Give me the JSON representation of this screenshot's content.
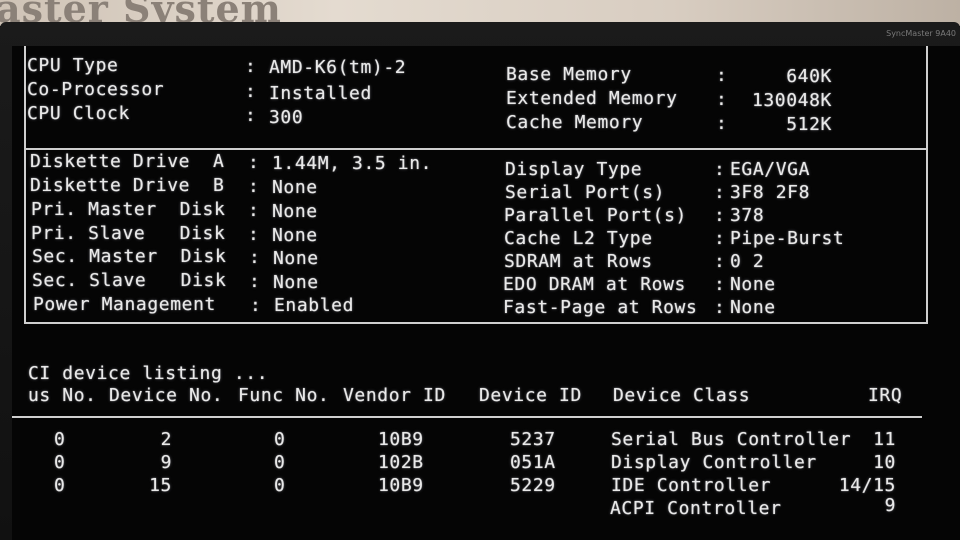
{
  "environment": {
    "wall_sign_text": "aster System",
    "monitor_brand": "SyncMaster 9A40"
  },
  "system": {
    "left": [
      {
        "label": "CPU Type",
        "value": "AMD-K6(tm)-2"
      },
      {
        "label": "Co-Processor",
        "value": "Installed"
      },
      {
        "label": "CPU Clock",
        "value": "300"
      }
    ],
    "right": [
      {
        "label": "Base Memory",
        "value": "640K"
      },
      {
        "label": "Extended Memory",
        "value": "130048K"
      },
      {
        "label": "Cache Memory",
        "value": "512K"
      }
    ]
  },
  "devices": {
    "left": [
      {
        "label": "Diskette Drive  A",
        "value": "1.44M, 3.5 in."
      },
      {
        "label": "Diskette Drive  B",
        "value": "None"
      },
      {
        "label": "Pri. Master  Disk",
        "value": "None"
      },
      {
        "label": "Pri. Slave   Disk",
        "value": "None"
      },
      {
        "label": "Sec. Master  Disk",
        "value": "None"
      },
      {
        "label": "Sec. Slave   Disk",
        "value": "None"
      },
      {
        "label": "Power Management",
        "value": "Enabled"
      }
    ],
    "right": [
      {
        "label": "Display Type",
        "value": "EGA/VGA"
      },
      {
        "label": "Serial Port(s)",
        "value": "3F8 2F8"
      },
      {
        "label": "Parallel Port(s)",
        "value": "378"
      },
      {
        "label": "Cache L2 Type",
        "value": "Pipe-Burst"
      },
      {
        "label": "SDRAM at Rows",
        "value": "0 2"
      },
      {
        "label": "EDO DRAM at Rows",
        "value": "None"
      },
      {
        "label": "Fast-Page at Rows",
        "value": "None"
      }
    ]
  },
  "pci": {
    "title": "CI device listing ...",
    "headers": {
      "bus": "us No.",
      "device": "Device No.",
      "func": "Func No.",
      "vendor": "Vendor ID",
      "device_id": "Device ID",
      "class": "Device Class",
      "irq": "IRQ"
    },
    "rows": [
      {
        "bus": "0",
        "device": "2",
        "func": "0",
        "vendor": "10B9",
        "device_id": "5237",
        "class": "Serial Bus Controller",
        "irq": "11"
      },
      {
        "bus": "0",
        "device": "9",
        "func": "0",
        "vendor": "102B",
        "device_id": "051A",
        "class": "Display Controller",
        "irq": "10"
      },
      {
        "bus": "0",
        "device": "15",
        "func": "0",
        "vendor": "10B9",
        "device_id": "5229",
        "class": "IDE Controller",
        "irq": "14/15"
      },
      {
        "bus": "",
        "device": "",
        "func": "",
        "vendor": "",
        "device_id": "",
        "class": "ACPI Controller",
        "irq": "9"
      }
    ]
  }
}
